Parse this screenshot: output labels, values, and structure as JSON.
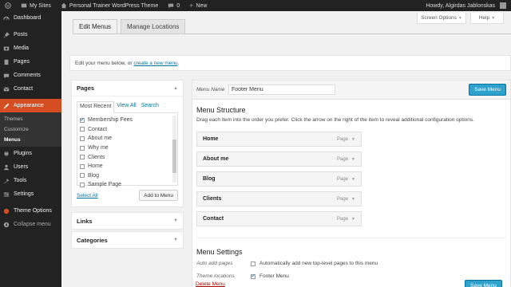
{
  "adminbar": {
    "my_sites": "My Sites",
    "site_name": "Personal Trainer WordPress Theme",
    "comments_count": "0",
    "new_label": "New",
    "howdy": "Howdy, Algirdas Jablonskas"
  },
  "sidebar": {
    "items": [
      {
        "label": "Dashboard",
        "icon": "dashboard-icon"
      },
      {
        "label": "Posts",
        "icon": "pin-icon"
      },
      {
        "label": "Media",
        "icon": "media-icon"
      },
      {
        "label": "Pages",
        "icon": "page-icon"
      },
      {
        "label": "Comments",
        "icon": "comment-icon"
      },
      {
        "label": "Contact",
        "icon": "mail-icon"
      },
      {
        "label": "Appearance",
        "icon": "brush-icon"
      },
      {
        "label": "Plugins",
        "icon": "plugin-icon"
      },
      {
        "label": "Users",
        "icon": "users-icon"
      },
      {
        "label": "Tools",
        "icon": "wrench-icon"
      },
      {
        "label": "Settings",
        "icon": "settings-icon"
      },
      {
        "label": "Theme Options",
        "icon": "theme-options-icon"
      },
      {
        "label": "Collapse menu",
        "icon": "collapse-icon"
      }
    ],
    "submenu": [
      "Themes",
      "Customize",
      "Menus"
    ],
    "accent_color": "#d54e21"
  },
  "screen_options": {
    "screen_options_label": "Screen Options",
    "help_label": "Help"
  },
  "tabs": {
    "edit_menus": "Edit Menus",
    "manage_locations": "Manage Locations"
  },
  "manage": {
    "text": "Edit your menu below, or ",
    "link": "create a new menu",
    "suffix": "."
  },
  "pages_box": {
    "title": "Pages",
    "tabs": [
      "Most Recent",
      "View All",
      "Search"
    ],
    "pages": [
      {
        "label": "Membership Fees",
        "checked": true
      },
      {
        "label": "Contact",
        "checked": false
      },
      {
        "label": "About me",
        "checked": false
      },
      {
        "label": "Why me",
        "checked": false
      },
      {
        "label": "Clients",
        "checked": false
      },
      {
        "label": "Home",
        "checked": false
      },
      {
        "label": "Blog",
        "checked": false
      },
      {
        "label": "Sample Page",
        "checked": false
      }
    ],
    "select_all": "Select All",
    "add_to_menu": "Add to Menu"
  },
  "links_box": {
    "title": "Links"
  },
  "categories_box": {
    "title": "Categories"
  },
  "menu": {
    "name_label": "Menu Name",
    "name_value": "Footer Menu",
    "save_label": "Save Menu",
    "structure_title": "Menu Structure",
    "structure_desc": "Drag each item into the order you prefer. Click the arrow on the right of the item to reveal additional configuration options.",
    "items": [
      {
        "label": "Home",
        "type": "Page"
      },
      {
        "label": "About me",
        "type": "Page"
      },
      {
        "label": "Blog",
        "type": "Page"
      },
      {
        "label": "Clients",
        "type": "Page"
      },
      {
        "label": "Contact",
        "type": "Page"
      }
    ],
    "settings_title": "Menu Settings",
    "auto_add_label": "Auto add pages",
    "auto_add_text": "Automatically add new top-level pages to this menu",
    "theme_locations_label": "Theme locations",
    "footer_menu_text": "Footer Menu",
    "delete_label": "Delete Menu"
  }
}
